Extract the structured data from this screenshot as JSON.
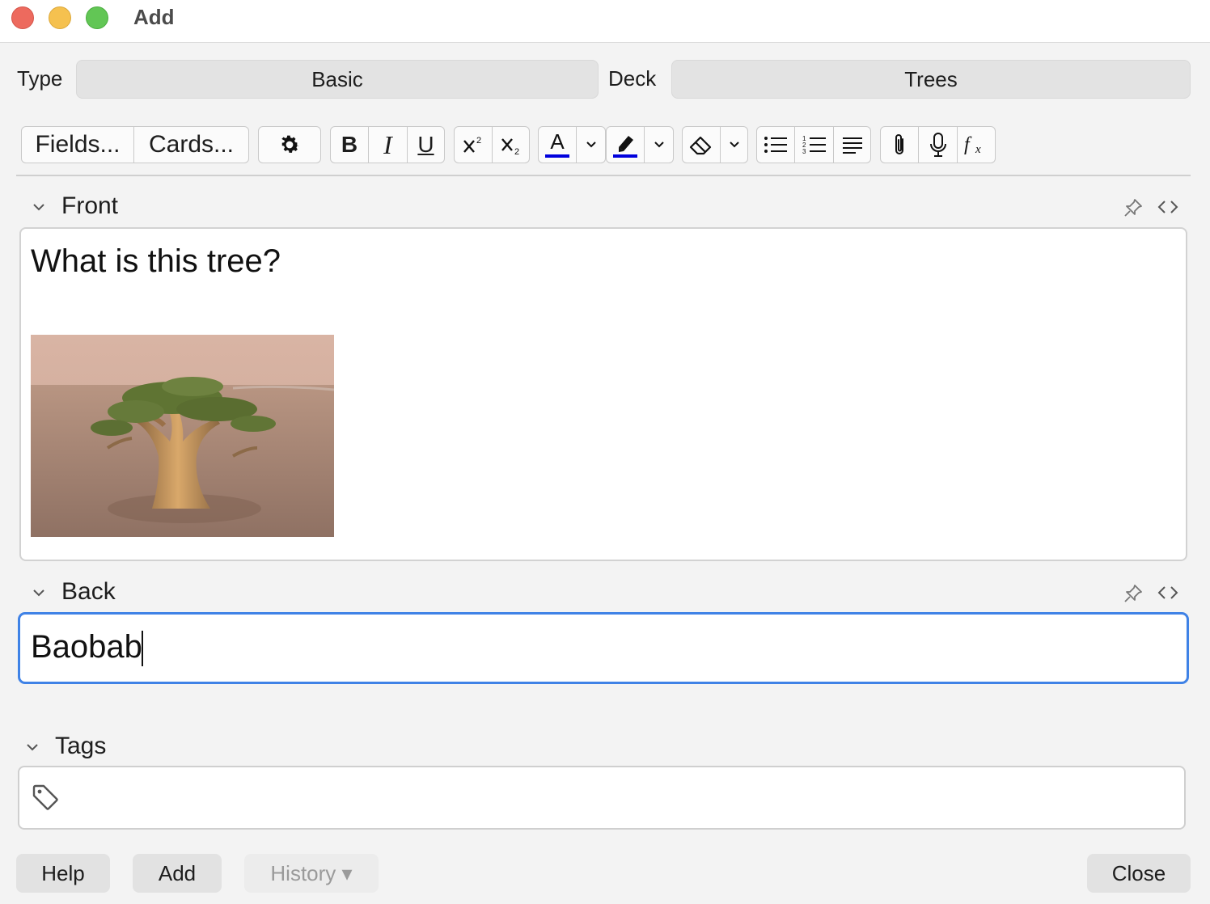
{
  "window": {
    "title": "Add"
  },
  "header": {
    "type_label": "Type",
    "type_value": "Basic",
    "deck_label": "Deck",
    "deck_value": "Trees"
  },
  "toolbar": {
    "fields_label": "Fields...",
    "cards_label": "Cards...",
    "bold_label": "B",
    "italic_label": "I",
    "underline_label": "U",
    "text_color": "#0000dd",
    "highlight_color": "#0000dd"
  },
  "fields": {
    "front": {
      "label": "Front",
      "text": "What is this tree?"
    },
    "back": {
      "label": "Back",
      "text": "Baobab"
    }
  },
  "tags": {
    "label": "Tags",
    "value": ""
  },
  "footer": {
    "help_label": "Help",
    "add_label": "Add",
    "history_label": "History ▾",
    "close_label": "Close"
  },
  "colors": {
    "focus_border": "#3f82e6",
    "window_bg": "#f3f3f3"
  }
}
